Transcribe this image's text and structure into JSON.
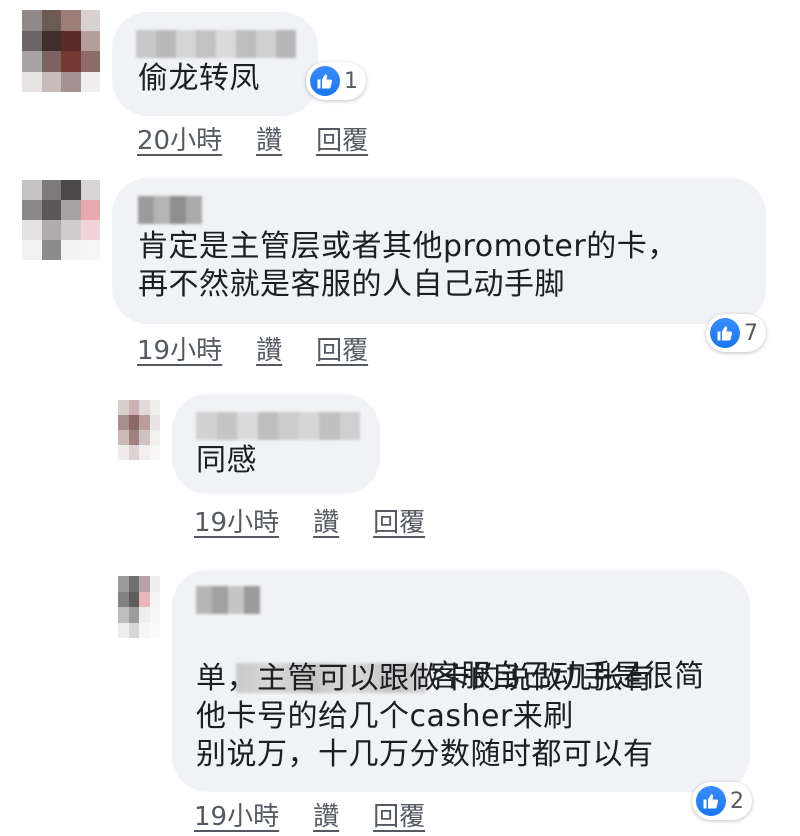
{
  "comments": [
    {
      "text": "偷龙转凤",
      "time": "20小時",
      "like_label": "讚",
      "reply_label": "回覆",
      "reaction_count": "1"
    },
    {
      "text": "肯定是主管层或者其他promoter的卡，\n再不然就是客服的人自己动手脚",
      "time": "19小時",
      "like_label": "讚",
      "reply_label": "回覆",
      "reaction_count": "7"
    },
    {
      "text": "同感",
      "time": "19小時",
      "like_label": "讚",
      "reply_label": "回覆"
    },
    {
      "text_first_line": "客服自己动手是很简",
      "text_rest": "单，主管可以跟做卡的说做几张有\n他卡号的给几个casher来刷\n别说万，十几万分数随时都可以有",
      "time": "19小時",
      "like_label": "讚",
      "reply_label": "回覆",
      "reaction_count": "2"
    }
  ],
  "icons": {
    "reaction": "thumbs-up-icon",
    "reaction_color": "#1877f2"
  }
}
